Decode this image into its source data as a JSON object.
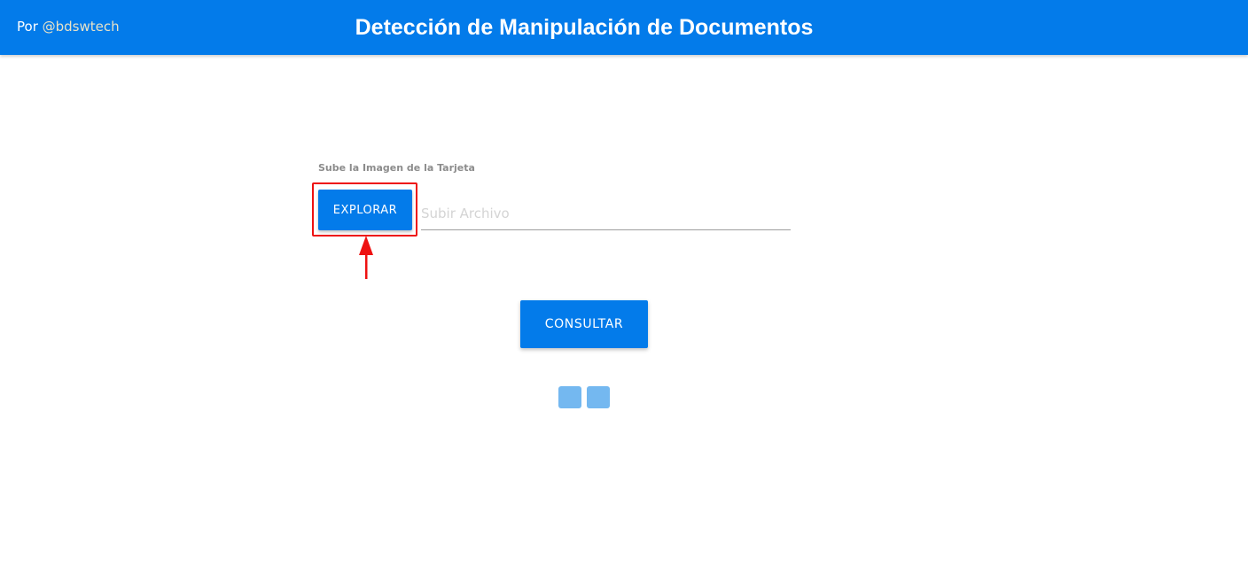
{
  "header": {
    "byline_prefix": "Por",
    "byline_handle": "@bdswtech",
    "title": "Detección de Manipulación de Documentos"
  },
  "upload": {
    "label": "Sube la Imagen de la Tarjeta",
    "explore_label": "EXPLORAR",
    "file_placeholder": "Subir Archivo",
    "file_value": ""
  },
  "actions": {
    "consult_label": "CONSULTAR"
  },
  "annotation": {
    "highlight_color": "#ee1111",
    "arrow_icon": "arrow-up-icon"
  },
  "loader": {
    "icon": "loading-squares-icon",
    "color": "#74b8f0"
  },
  "colors": {
    "primary": "#037bea",
    "header_text": "#ffffff",
    "handle_text": "#e9e3c7"
  }
}
